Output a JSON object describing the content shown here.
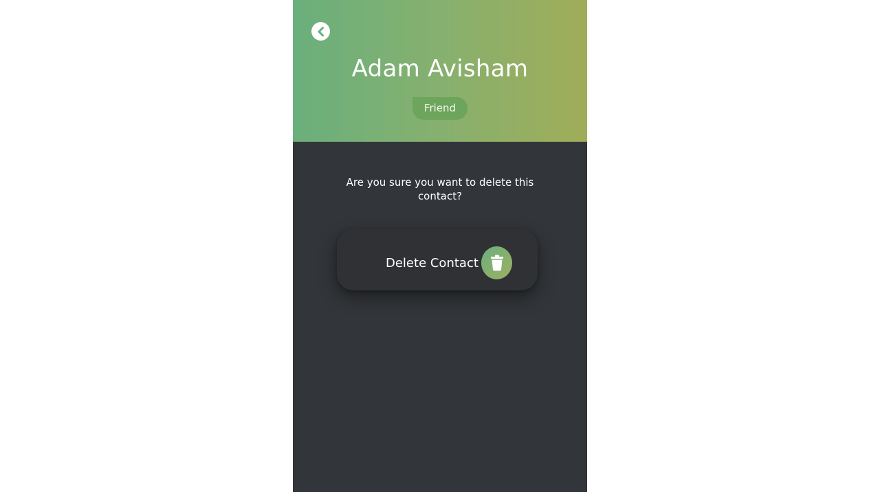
{
  "contact": {
    "name": "Adam Avisham",
    "group": "Friend"
  },
  "dialog": {
    "message": "Are you sure you want to delete this contact?",
    "delete_label": "Delete Contact"
  },
  "icons": {
    "back": "chevron-left-circle-icon",
    "delete": "trash-icon"
  },
  "colors": {
    "header_gradient_start": "#6aaf7c",
    "header_gradient_end": "#a0ad58",
    "background": "#323539",
    "badge": "#6da55c",
    "card": "#2f3135"
  }
}
